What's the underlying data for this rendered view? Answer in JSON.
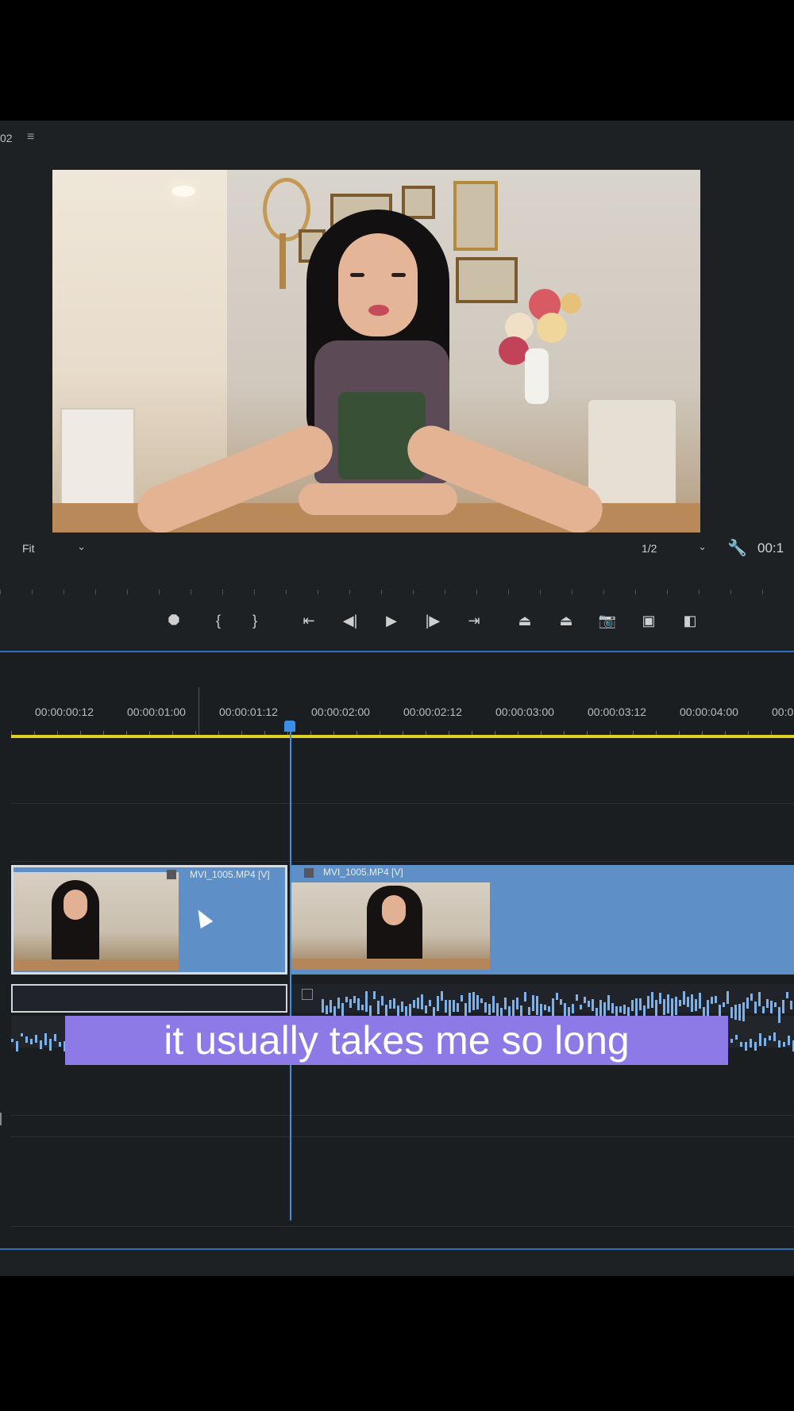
{
  "program_monitor": {
    "panel_label": "02",
    "menu_icon": "hamburger-menu-icon",
    "fit_select": {
      "value": "Fit"
    },
    "resolution_select": {
      "value": "1/2"
    },
    "timecode": "00:1"
  },
  "transport": {
    "buttons": [
      {
        "name": "add-marker-icon",
        "glyph": "⯃"
      },
      {
        "name": "mark-in-icon",
        "glyph": "{"
      },
      {
        "name": "mark-out-icon",
        "glyph": "}"
      },
      {
        "name": "go-to-in-icon",
        "glyph": "⇤"
      },
      {
        "name": "step-back-icon",
        "glyph": "◀|"
      },
      {
        "name": "play-icon",
        "glyph": "▶"
      },
      {
        "name": "step-forward-icon",
        "glyph": "|▶"
      },
      {
        "name": "go-to-out-icon",
        "glyph": "⇥"
      },
      {
        "name": "lift-icon",
        "glyph": "⏏"
      },
      {
        "name": "extract-icon",
        "glyph": "⏏"
      },
      {
        "name": "export-frame-icon",
        "glyph": "📷"
      },
      {
        "name": "insert-icon",
        "glyph": "▣"
      },
      {
        "name": "overwrite-icon",
        "glyph": "◧"
      }
    ]
  },
  "timeline": {
    "ruler_labels": [
      "00:00:00:12",
      "00:00:01:00",
      "00:00:01:12",
      "00:00:02:00",
      "00:00:02:12",
      "00:00:03:00",
      "00:00:03:12",
      "00:00:04:00",
      "00:0"
    ],
    "playhead_timecode_position": "00:00:01:12",
    "clips": [
      {
        "title": "MVI_1005.MP4 [V]"
      },
      {
        "title": "MVI_1005.MP4 [V]"
      }
    ]
  },
  "caption": {
    "text": "it usually takes me so long"
  },
  "colors": {
    "clip_blue": "#5e8fc6",
    "playhead_blue": "#3a8ee6",
    "work_area_yellow": "#e0d020",
    "caption_purple": "#8e7ae6"
  }
}
